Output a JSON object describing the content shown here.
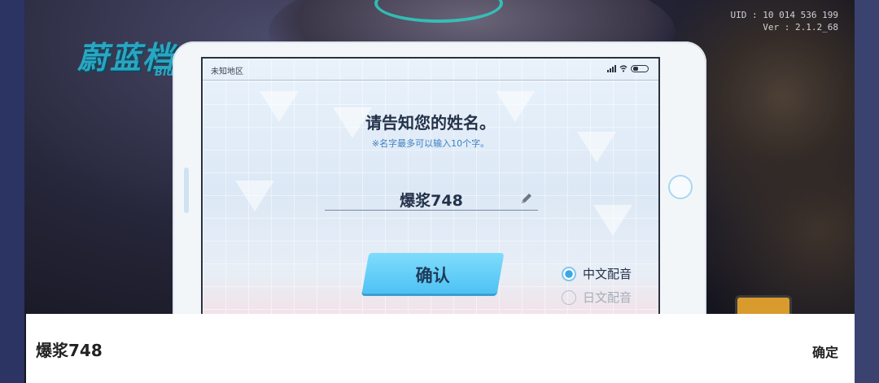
{
  "game": {
    "logo_text": "蔚蓝档案",
    "logo_sub": "Blue",
    "uid_line": "UID : 10 014 536 199",
    "version_line": "Ver : 2.1.2_68"
  },
  "tablet": {
    "status_location": "未知地区",
    "title": "请告知您的姓名。",
    "hint": "※名字最多可以输入10个字。",
    "name_value": "爆浆748",
    "confirm_label": "确认",
    "voice_options": [
      {
        "label": "中文配音",
        "selected": true
      },
      {
        "label": "日文配音",
        "selected": false
      }
    ]
  },
  "keyboard_bar": {
    "input_text": "爆浆748",
    "confirm_label": "确定"
  },
  "colors": {
    "accent": "#4ec2f4",
    "logo": "#2aa6c2",
    "hint": "#3c7fc0"
  },
  "icons": [
    "pencil-icon",
    "signal-icon",
    "wifi-icon",
    "battery-icon",
    "home-button-icon"
  ]
}
